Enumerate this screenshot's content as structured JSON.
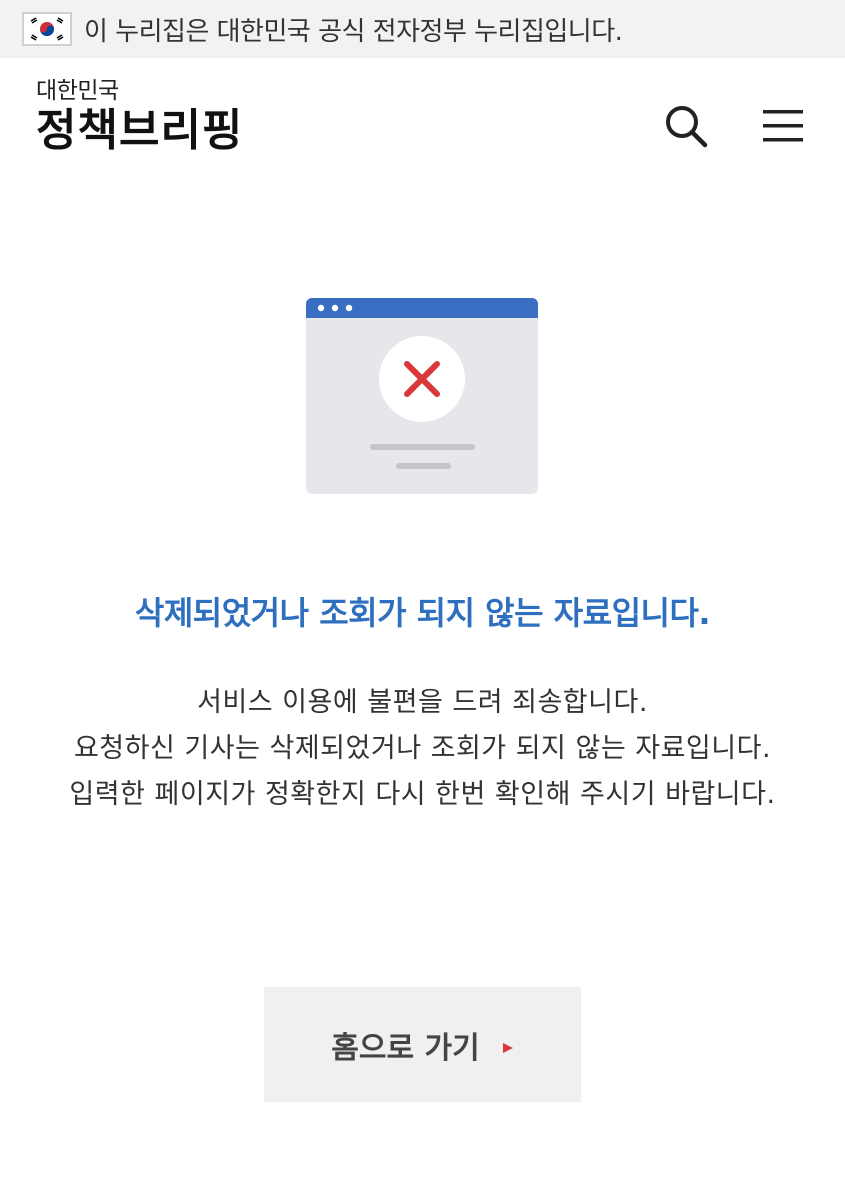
{
  "gov_banner": {
    "text": "이 누리집은 대한민국 공식 전자정부 누리집입니다.",
    "flag_icon": "korea-flag-icon"
  },
  "header": {
    "logo_small": "대한민국",
    "logo_main": "정책브리핑",
    "search_icon": "search-icon",
    "menu_icon": "hamburger-menu-icon"
  },
  "error": {
    "illustration_icon": "browser-error-icon",
    "title": "삭제되었거나 조회가 되지 않는 자료입니다.",
    "lines": [
      "서비스 이용에 불편을 드려 죄송합니다.",
      "요청하신 기사는 삭제되었거나 조회가 되지 않는 자료입니다.",
      "입력한 페이지가 정확한지 다시 한번 확인해 주시기 바랍니다."
    ],
    "home_button_label": "홈으로 가기"
  },
  "colors": {
    "accent_blue": "#2f6fbf",
    "error_red": "#d9383a",
    "logo_red": "#e0352b"
  }
}
